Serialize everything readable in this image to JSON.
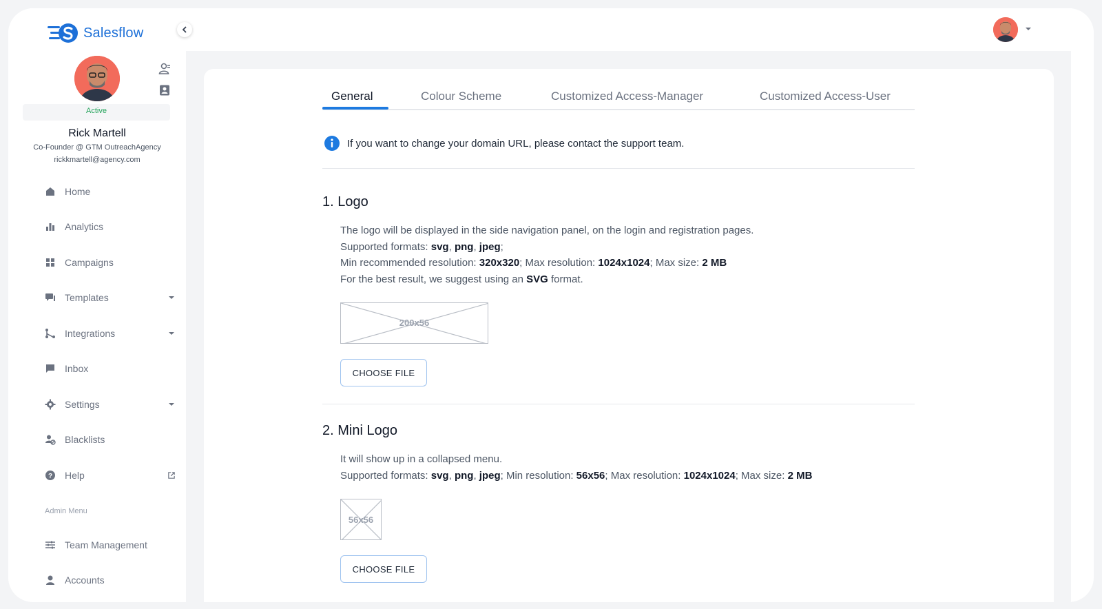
{
  "brand": {
    "name": "Salesflow",
    "color": "#1d70d8"
  },
  "profile": {
    "status": "Active",
    "name": "Rick Martell",
    "role": "Co-Founder @ GTM OutreachAgency",
    "email": "rickkmartell@agency.com"
  },
  "nav": {
    "home": "Home",
    "analytics": "Analytics",
    "campaigns": "Campaigns",
    "templates": "Templates",
    "integrations": "Integrations",
    "inbox": "Inbox",
    "settings": "Settings",
    "blacklists": "Blacklists",
    "help": "Help",
    "admin_label": "Admin Menu",
    "team_management": "Team Management",
    "accounts": "Accounts"
  },
  "tabs": [
    "General",
    "Colour Scheme",
    "Customized Access-Manager",
    "Customized Access-User"
  ],
  "active_tab": "General",
  "info": "If you want to change your domain URL, please contact the support team.",
  "logo_section": {
    "title": "1.  Logo",
    "line1": "The logo will be displayed in the side navigation panel, on the login and registration pages.",
    "formats_label": "Supported formats: ",
    "fmt_svg": "svg",
    "fmt_png": "png",
    "fmt_jpeg": "jpeg",
    "min_label": "Min recommended resolution: ",
    "min_value": "320x320",
    "max_label": "; Max resolution: ",
    "max_value": "1024x1024",
    "size_label": "; Max size: ",
    "size_value": "2 MB",
    "best_prefix": "For the best result, we suggest using an ",
    "best_value": "SVG",
    "best_suffix": " format.",
    "placeholder": "200x56",
    "button": "CHOOSE FILE"
  },
  "mini_logo_section": {
    "title": "2.  Mini Logo",
    "line1": "It will show up in a collapsed menu.",
    "formats_label": "Supported formats: ",
    "fmt_svg": "svg",
    "fmt_png": "png",
    "fmt_jpeg": "jpeg",
    "min_label": "; Min resolution: ",
    "min_value": "56x56",
    "max_label": "; Max resolution: ",
    "max_value": "1024x1024",
    "size_label": "; Max size: ",
    "size_value": "2 MB",
    "placeholder": "56x56",
    "button": "CHOOSE FILE"
  },
  "colors": {
    "accent": "#1d7ae0",
    "active_status": "#22a35a",
    "avatar_bg": "#f26b5b"
  }
}
